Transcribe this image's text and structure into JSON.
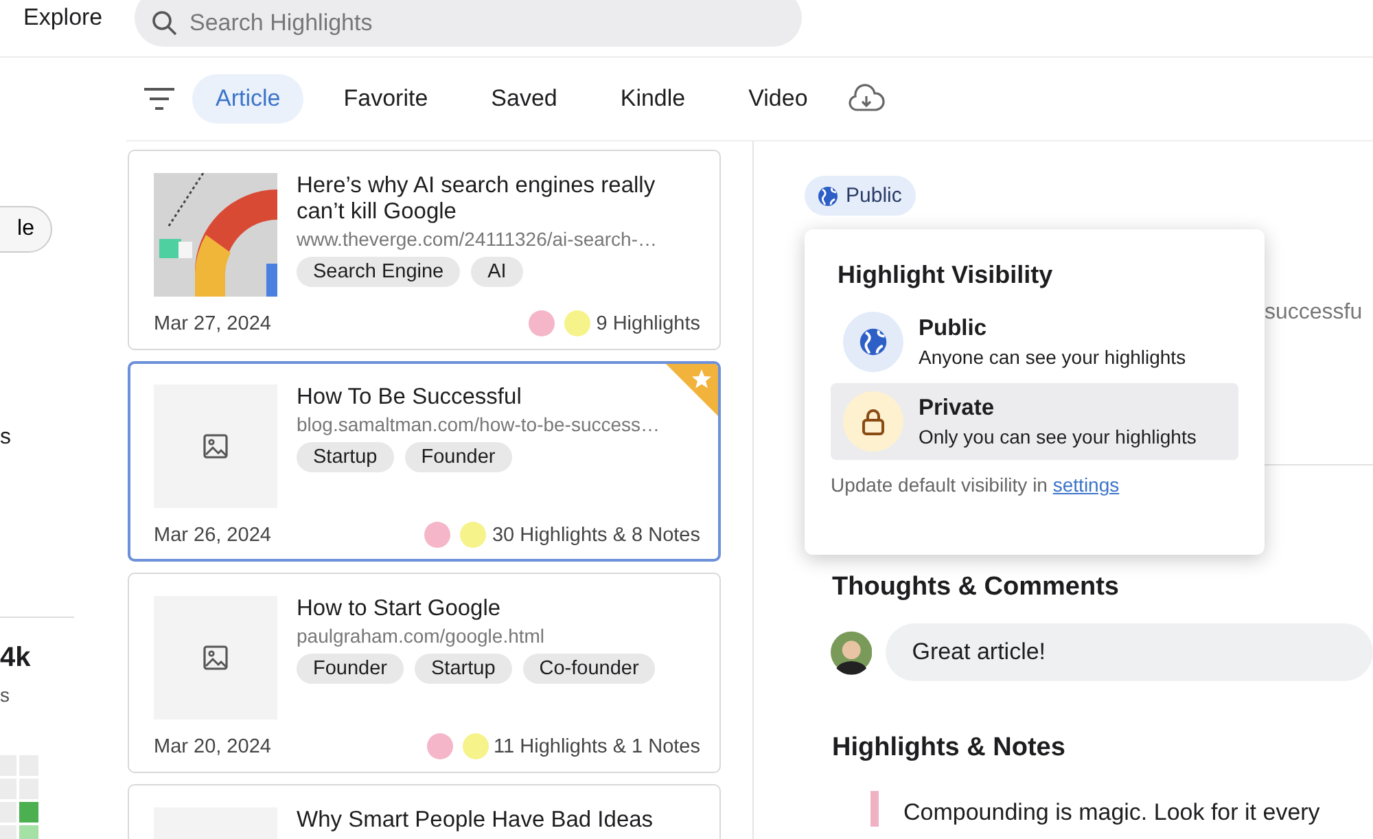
{
  "header": {
    "title": "Explore",
    "search": {
      "placeholder": "Search Highlights"
    }
  },
  "tabs": [
    {
      "label": "Article",
      "selected": true
    },
    {
      "label": "Favorite",
      "selected": false
    },
    {
      "label": "Saved",
      "selected": false
    },
    {
      "label": "Kindle",
      "selected": false
    },
    {
      "label": "Video",
      "selected": false
    }
  ],
  "sidebar": {
    "button": "le",
    "label": "s",
    "stat": "4k",
    "stat_label": "s"
  },
  "cards": [
    {
      "title": "Here’s why AI search engines really can’t kill Google",
      "url": "www.theverge.com/24111326/ai-search-…",
      "tags": [
        "Search Engine",
        "AI"
      ],
      "date": "Mar 27, 2024",
      "markers": [
        {
          "color": "#f4b6c8"
        },
        {
          "color": "#f6f38a"
        }
      ],
      "count": "9 Highlights",
      "kind": "picture",
      "selected": false,
      "favorite": false
    },
    {
      "title": "How To Be Successful",
      "url": "blog.samaltman.com/how-to-be-success…",
      "tags": [
        "Startup",
        "Founder"
      ],
      "date": "Mar 26, 2024",
      "markers": [
        {
          "color": "#f4b6c8"
        },
        {
          "color": "#f6f38a"
        }
      ],
      "count": "30 Highlights & 8 Notes",
      "kind": "placeholder",
      "selected": true,
      "favorite": true
    },
    {
      "title": "How to Start Google",
      "url": "paulgraham.com/google.html",
      "tags": [
        "Founder",
        "Startup",
        "Co-founder"
      ],
      "date": "Mar 20, 2024",
      "markers": [
        {
          "color": "#f4b6c8"
        },
        {
          "color": "#f6f38a"
        }
      ],
      "count": "11 Highlights & 1 Notes",
      "kind": "placeholder",
      "selected": false,
      "favorite": false
    },
    {
      "title": "Why Smart People Have Bad Ideas",
      "kind": "placeholder",
      "selected": false,
      "favorite": false
    }
  ],
  "detail": {
    "visibility": "Public",
    "behind_text": "successfu",
    "comments_heading": "Thoughts & Comments",
    "comment": "Great article!",
    "highlights_heading": "Highlights & Notes",
    "highlight": "Compounding is magic. Look for it every"
  },
  "popup": {
    "title": "Highlight Visibility",
    "options": [
      {
        "kind": "public",
        "label": "Public",
        "description": "Anyone can see your highlights",
        "selected": false
      },
      {
        "kind": "private",
        "label": "Private",
        "description": "Only you can see your highlights",
        "selected": true
      }
    ],
    "footer": "Update default visibility in",
    "link": "settings"
  }
}
